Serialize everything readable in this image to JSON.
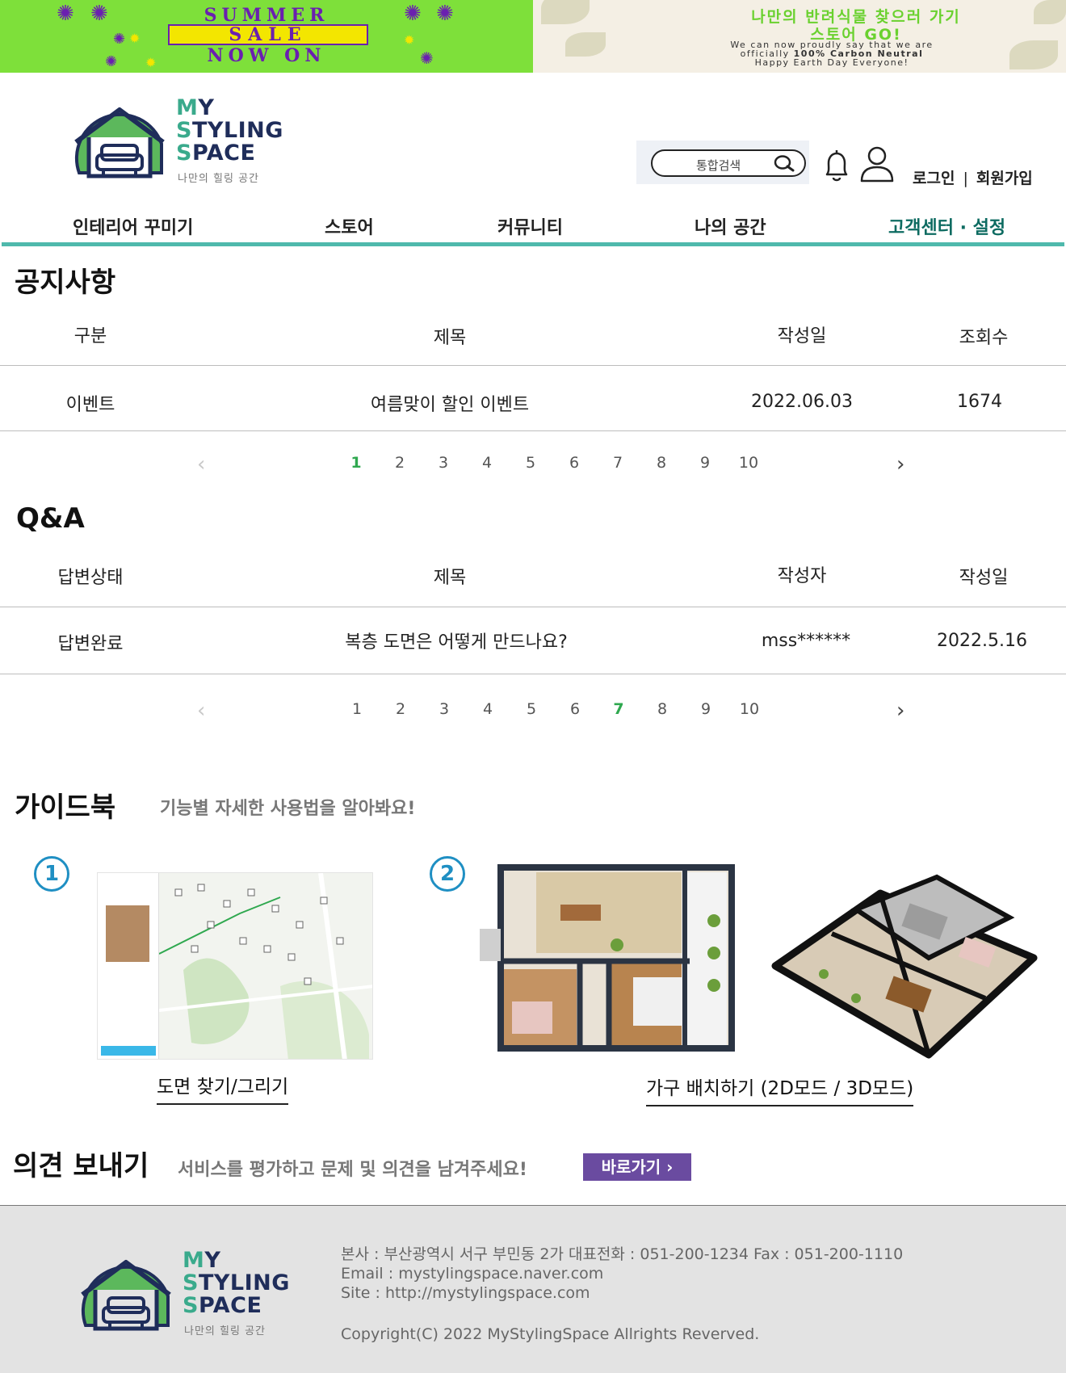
{
  "banners": {
    "left": {
      "line1": "SUMMER",
      "line2": "SALE",
      "line3": "NOW ON"
    },
    "right": {
      "line1": "나만의 반려식물 찾으러 가기",
      "line2": "스토어 GO!",
      "line3a": "We can now proudly say that we are",
      "line3b_prefix": "officially ",
      "line3b_bold": "100% Carbon Neutral",
      "line3c": "Happy Earth Day Everyone!"
    }
  },
  "brand": {
    "line1_first": "M",
    "line1_rest": "Y",
    "line2_first": "S",
    "line2_rest": "TYLING",
    "line3_first": "S",
    "line3_rest": "PACE",
    "tagline": "나만의 힐링 공간",
    "colors": {
      "navy": "#1f2d5a",
      "teal": "#3aaa8c",
      "green": "#5cb85c"
    }
  },
  "header": {
    "search_label": "통합검색",
    "login": "로그인",
    "divider": "|",
    "signup": "회원가입"
  },
  "nav": {
    "items": [
      "인테리어 꾸미기",
      "스토어",
      "커뮤니티",
      "나의 공간",
      "고객센터 · 설정"
    ],
    "active_index": 4
  },
  "notice": {
    "title": "공지사항",
    "headers": [
      "구분",
      "제목",
      "작성일",
      "조회수"
    ],
    "rows": [
      [
        "이벤트",
        "여름맞이 할인 이벤트",
        "2022.06.03",
        "1674"
      ]
    ],
    "pages": [
      "1",
      "2",
      "3",
      "4",
      "5",
      "6",
      "7",
      "8",
      "9",
      "10"
    ],
    "current_page": "1",
    "prev": "‹",
    "next": "›"
  },
  "qna": {
    "title": "Q&A",
    "headers": [
      "답변상태",
      "제목",
      "작성자",
      "작성일"
    ],
    "rows": [
      [
        "답변완료",
        "복층 도면은 어떻게 만드나요?",
        "mss******",
        "2022.5.16"
      ]
    ],
    "pages": [
      "1",
      "2",
      "3",
      "4",
      "5",
      "6",
      "7",
      "8",
      "9",
      "10"
    ],
    "current_page": "7",
    "prev": "‹",
    "next": "›"
  },
  "guide": {
    "title": "가이드북",
    "subtitle": "기능별 자세한 사용법을 알아봐요!",
    "steps": [
      {
        "number": "1",
        "caption": "도면 찾기/그리기"
      },
      {
        "number": "2",
        "caption": "가구 배치하기 (2D모드 / 3D모드)"
      }
    ]
  },
  "feedback": {
    "title": "의견 보내기",
    "subtitle": "서비스를 평가하고 문제 및 의견을 남겨주세요!",
    "button": "바로가기 ›"
  },
  "footer": {
    "address": "본사 : 부산광역시 서구 부민동 2가  대표전화 : 051-200-1234 Fax : 051-200-1110",
    "email": "Email : mystylingspace.naver.com",
    "site": "Site : http://mystylingspace.com",
    "copyright": "Copyright(C) 2022 MyStylingSpace Allrights Reverved."
  },
  "icons": {
    "search": "search-icon",
    "bell": "bell-icon",
    "user": "user-icon",
    "house": "house-logo-icon",
    "sofa": "sofa-icon"
  },
  "accent_color": "#4fb9ac",
  "active_page_color": "#2fa84f",
  "button_color": "#6a4ba0"
}
